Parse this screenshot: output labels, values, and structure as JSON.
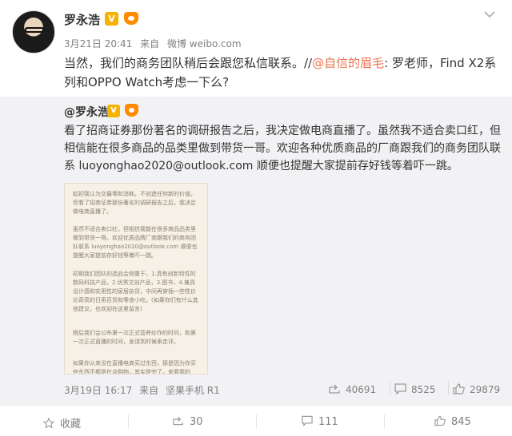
{
  "author": {
    "name": "罗永浩",
    "verified_badge": "V",
    "icons": {
      "avatar": "avatar",
      "vip": "vip-crown-icon",
      "menu": "chevron-down-icon"
    }
  },
  "post": {
    "date": "3月21日 20:41",
    "source_prefix": "来自",
    "source": "微博 weibo.com",
    "text_part1": "当然，我们的商务团队稍后会跟您私信联系。//",
    "mention": "@自信的眉毛",
    "text_part2": ": 罗老师，Find X2系列和OPPO Watch考虑一下么?"
  },
  "repost": {
    "user": "@罗永浩",
    "verified_badge": "V",
    "text": "看了招商证券那份著名的调研报告之后，我决定做电商直播了。虽然我不适合卖口红，但相信能在很多商品的品类里做到带货一哥。欢迎各种优质商品的厂商跟我们的商务团队联系 luoyonghao2020@outlook.com 顺便也提醒大家提前存好钱等着吓一跳。",
    "article_image_paragraphs": [
      "起初我认为交最零和消耗，不创造任何新的价值，但看了招商证券那份著名的调研报告之后，我决定做电商直播了。",
      "虽然不适合卖口红，但相信我能在很多商品品类里做到带货一哥。欢迎优质品牌厂商跟我们的商务团队联系 luoyonghao2020@outlook.com 顺便也提醒大家提前存好钱等着吓一跳。",
      "初期我们团队的选品会侧重于，1.具有创新特性的数码科技产品，2.优秀文创产品，3.图书，4.兼具设计感和实用性的家居杂货，中间再穿插一些性价比奇高的日用百货和零食小吃。(如果你们有什么其他建议，也欢迎在这里留言)",
      "稍后我们会公布第一次正式营养炒作的时间，和第一次正式直播的时间，发请到时候来走评。",
      "如果你从来没在直播电商买过东西，那是因为你买些东西不都是在点购物，其实是完了。来看我的"
    ],
    "date": "3月19日 16:17",
    "source_prefix": "来自",
    "source": "坚果手机 R1",
    "stats": {
      "forwards": "40691",
      "comments": "8525",
      "likes": "29879"
    }
  },
  "actions": {
    "favorite_label": "收藏",
    "repost_count": "30",
    "comment_count": "111",
    "like_count": "845"
  },
  "colors": {
    "mention": "#eb7350",
    "repost_bg": "#f2f2f5",
    "badge": "#f6b200",
    "vip": "#ff8c00"
  }
}
